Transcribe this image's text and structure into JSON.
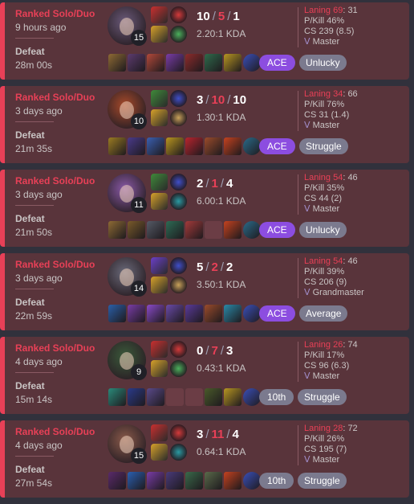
{
  "matches": [
    {
      "queue": "Ranked Solo/Duo",
      "ago": "9 hours ago",
      "result": "Defeat",
      "duration": "28m 00s",
      "champion_level": "15",
      "kills": "10",
      "deaths": "5",
      "assists": "1",
      "kda_ratio": "2.20:1 KDA",
      "laning_label": "Laning 69",
      "laning_opp": ": 31",
      "pkill": "P/Kill 46%",
      "cs": "CS 239 (8.5)",
      "avg_rank": "Master",
      "badge": "ACE",
      "badge_style": "purple",
      "tag": "Unlucky",
      "spell_colors": [
        "#c92f2f",
        "#d6a12a"
      ],
      "rune_colors": [
        "#d33a3a",
        "#4bb05c"
      ],
      "item_colors": [
        "#8e6a34",
        "#5c3b6e",
        "#b2493a",
        "#7a3ca6",
        "#8d2b2b",
        "#2f6b4b",
        "#b79622",
        "#3a4fb8"
      ]
    },
    {
      "queue": "Ranked Solo/Duo",
      "ago": "3 days ago",
      "result": "Defeat",
      "duration": "21m 35s",
      "champion_level": "10",
      "kills": "3",
      "deaths": "10",
      "assists": "10",
      "kda_ratio": "1.30:1 KDA",
      "laning_label": "Laning 34",
      "laning_opp": ": 66",
      "pkill": "P/Kill 76%",
      "cs": "CS 31 (1.4)",
      "avg_rank": "Master",
      "badge": "ACE",
      "badge_style": "purple",
      "tag": "Struggle",
      "spell_colors": [
        "#3f8a3a",
        "#d6a12a"
      ],
      "rune_colors": [
        "#3f4fc8",
        "#c8a25a"
      ],
      "item_colors": [
        "#9a7b22",
        "#4a3a8a",
        "#3a5fb0",
        "#b8951f",
        "#b8242e",
        "#9a4b2b",
        "#c4421f",
        "#2a6b8a"
      ]
    },
    {
      "queue": "Ranked Solo/Duo",
      "ago": "3 days ago",
      "result": "Defeat",
      "duration": "21m 50s",
      "champion_level": "11",
      "kills": "2",
      "deaths": "1",
      "assists": "4",
      "kda_ratio": "6.00:1 KDA",
      "laning_label": "Laning 54",
      "laning_opp": ": 46",
      "pkill": "P/Kill 35%",
      "cs": "CS 44 (2)",
      "avg_rank": "Master",
      "badge": "ACE",
      "badge_style": "purple",
      "tag": "Unlucky",
      "spell_colors": [
        "#3f8a3a",
        "#d6a12a"
      ],
      "rune_colors": [
        "#3f4fc8",
        "#2a9aa2"
      ],
      "item_colors": [
        "#8e6a34",
        "#7a5a2a",
        "#555a66",
        "#2d6b54",
        "#a33a3a",
        "",
        "#c4421f",
        "#2a6b8a"
      ]
    },
    {
      "queue": "Ranked Solo/Duo",
      "ago": "3 days ago",
      "result": "Defeat",
      "duration": "22m 59s",
      "champion_level": "14",
      "kills": "5",
      "deaths": "2",
      "assists": "2",
      "kda_ratio": "3.50:1 KDA",
      "laning_label": "Laning 54",
      "laning_opp": ": 46",
      "pkill": "P/Kill 39%",
      "cs": "CS 206 (9)",
      "avg_rank": "Grandmaster",
      "badge": "ACE",
      "badge_style": "purple",
      "tag": "Average",
      "spell_colors": [
        "#6b3fc8",
        "#d6a12a"
      ],
      "rune_colors": [
        "#3f4fc8",
        "#c8a25a"
      ],
      "item_colors": [
        "#2a5fa8",
        "#7a3ca6",
        "#8a4ac8",
        "#6a4aa8",
        "#5a3a9a",
        "#9a4b2b",
        "#2a8aa8",
        "#3a4fb8"
      ]
    },
    {
      "queue": "Ranked Solo/Duo",
      "ago": "4 days ago",
      "result": "Defeat",
      "duration": "15m 14s",
      "champion_level": "9",
      "kills": "0",
      "deaths": "7",
      "assists": "3",
      "kda_ratio": "0.43:1 KDA",
      "laning_label": "Laning 26",
      "laning_opp": ": 74",
      "pkill": "P/Kill 17%",
      "cs": "CS 96 (6.3)",
      "avg_rank": "Master",
      "badge": "10th",
      "badge_style": "gray",
      "tag": "Struggle",
      "spell_colors": [
        "#c92f2f",
        "#d6a12a"
      ],
      "rune_colors": [
        "#d33a3a",
        "#4bb05c"
      ],
      "item_colors": [
        "#2a8a7a",
        "#2a3a8a",
        "#5a4a8a",
        "",
        "",
        "#4a5a2a",
        "#b79622",
        "#3a4fb8"
      ]
    },
    {
      "queue": "Ranked Solo/Duo",
      "ago": "4 days ago",
      "result": "Defeat",
      "duration": "27m 54s",
      "champion_level": "15",
      "kills": "3",
      "deaths": "11",
      "assists": "4",
      "kda_ratio": "0.64:1 KDA",
      "laning_label": "Laning 28",
      "laning_opp": ": 72",
      "pkill": "P/Kill 26%",
      "cs": "CS 195 (7)",
      "avg_rank": "Master",
      "badge": "10th",
      "badge_style": "gray",
      "tag": "Struggle",
      "spell_colors": [
        "#c92f2f",
        "#d6a12a"
      ],
      "rune_colors": [
        "#d33a3a",
        "#2a9aa2"
      ],
      "item_colors": [
        "#5a2a6a",
        "#2a5fb0",
        "#7a3ca6",
        "#4a3a7a",
        "#3a6a4a",
        "#5a6a4a",
        "#c4421f",
        "#3a4fb8"
      ]
    }
  ],
  "champion_colors": [
    "#6a5a7a",
    "#a84a2a",
    "#8a5aa8",
    "#6a6a7a",
    "#3a5a3a",
    "#8a5a4a"
  ]
}
